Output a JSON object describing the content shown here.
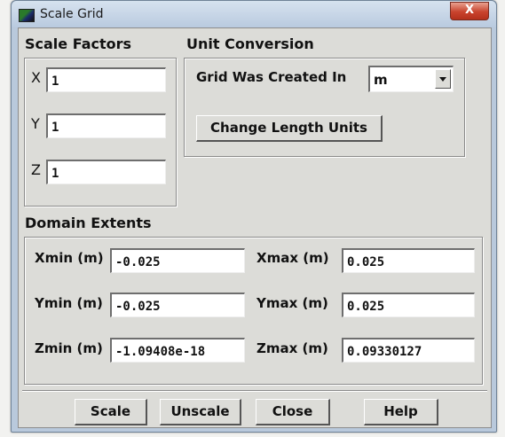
{
  "window": {
    "title": "Scale Grid",
    "close_glyph": "X"
  },
  "scale_factors": {
    "label": "Scale Factors",
    "fields": [
      {
        "axis": "X",
        "value": "1"
      },
      {
        "axis": "Y",
        "value": "1"
      },
      {
        "axis": "Z",
        "value": "1"
      }
    ]
  },
  "unit_conversion": {
    "label": "Unit Conversion",
    "grid_created_label": "Grid Was Created In",
    "grid_unit": "m",
    "change_units_button": "Change Length Units"
  },
  "domain_extents": {
    "label": "Domain Extents",
    "xmin": {
      "label": "Xmin (m)",
      "value": "-0.025"
    },
    "xmax": {
      "label": "Xmax (m)",
      "value": "0.025"
    },
    "ymin": {
      "label": "Ymin (m)",
      "value": "-0.025"
    },
    "ymax": {
      "label": "Ymax (m)",
      "value": "0.025"
    },
    "zmin": {
      "label": "Zmin (m)",
      "value": "-1.09408e-18"
    },
    "zmax": {
      "label": "Zmax (m)",
      "value": "0.09330127"
    }
  },
  "buttons": {
    "scale": "Scale",
    "unscale": "Unscale",
    "close": "Close",
    "help": "Help"
  }
}
